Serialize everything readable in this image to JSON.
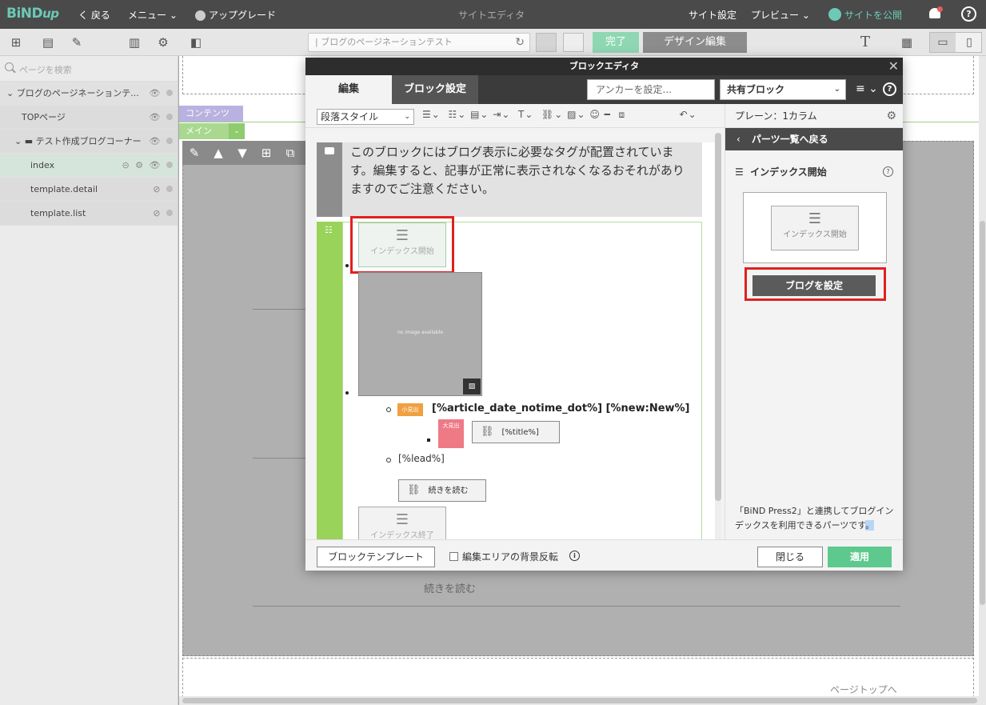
{
  "topbar": {
    "logo": "BiND",
    "logo_suffix": "up",
    "back": "く 戻る",
    "menu": "メニュー ⌄",
    "upgrade": "アップグレード",
    "title": "サイトエディタ",
    "site_settings": "サイト設定",
    "preview": "プレビュー ⌄",
    "publish": "サイトを公開"
  },
  "toolbar": {
    "page_select": "| ブログのページネーションテスト",
    "done": "完了",
    "design_edit": "デザイン編集"
  },
  "sidebar": {
    "search_placeholder": "ページを検索",
    "items": [
      {
        "label": "ブログのページネーションテ..."
      },
      {
        "label": "TOPページ"
      },
      {
        "label": "テスト作成ブログコーナー"
      },
      {
        "label": "index"
      },
      {
        "label": "template.detail"
      },
      {
        "label": "template.list"
      }
    ]
  },
  "canvas": {
    "label_contents": "コンテンツ",
    "label_main": "メイン",
    "read_more": "続きを読む",
    "page_top": "ページトップへ"
  },
  "modal": {
    "title": "ブロックエディタ",
    "tab_edit": "編集",
    "tab_block_settings": "ブロック設定",
    "anchor_placeholder": "アンカーを設定...",
    "shared_block": "共有ブロック",
    "paragraph_style": "段落スタイル",
    "warning_text": "このブロックにはブログ表示に必要なタグが配置されています。編集すると、記事が正常に表示されなくなるおそれがありますのでご注意ください。",
    "index_start": "インデックス開始",
    "no_image": "no image available",
    "tag_small": "小見出",
    "tag_large": "大見出",
    "date_line": "[%article_date_notime_dot%] [%new:New%]",
    "title_tag": "[%title%]",
    "lead_tag": "[%lead%]",
    "read_more": "続きを読む",
    "index_end": "インデックス終了",
    "panel": {
      "header": "プレーン：1カラム",
      "back": "パーツ一覧へ戻る",
      "section_title": "インデックス開始",
      "preview_label": "インデックス開始",
      "blog_button": "ブログを設定",
      "description_a": "「BiND Press2」と連携してブログインデックスを利用できるパーツです",
      "description_b": "。"
    },
    "footer": {
      "template": "ブロックテンプレート",
      "bg_invert": "編集エリアの背景反転",
      "close": "閉じる",
      "apply": "適用"
    }
  },
  "colors": {
    "accent_green": "#5dc98e",
    "highlight_red": "#e02020",
    "topbar": "#4a4a4a"
  }
}
